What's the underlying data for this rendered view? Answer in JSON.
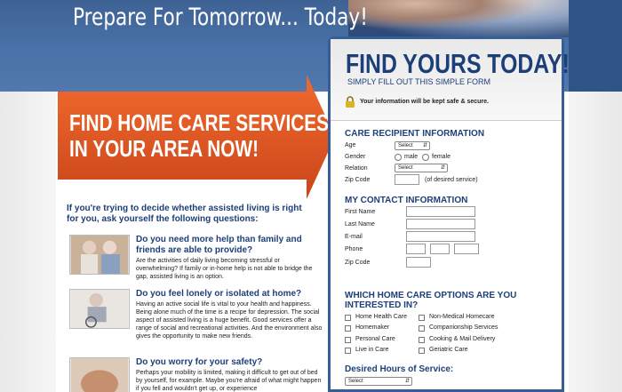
{
  "hero": {
    "title": "Prepare For Tomorrow... Today!"
  },
  "banner": {
    "line1": "FIND HOME CARE SERVICES",
    "line2": "IN YOUR AREA NOW!"
  },
  "intro": {
    "text": "If you're trying to decide whether assisted living is right for you, ask yourself the following questions:"
  },
  "questions": [
    {
      "title": "Do you need more help than family and friends are able to provide?",
      "body": "Are the activities of daily living becoming stressful or overwhelming? If family or in-home help is not able to bridge the gap, assisted living is an option."
    },
    {
      "title": "Do you feel lonely or isolated at home?",
      "body": "Having an active social life is vital to your health and happiness. Being alone much of the time is a recipe for depression. The social aspect of assisted living is a huge benefit. Good services offer a range of social and recreational activities. And the environment also gives the opportunity to make new friends."
    },
    {
      "title": "Do you worry for your safety?",
      "body": "Perhaps your mobility is limited, making it difficult to get out of bed by yourself, for example. Maybe you're afraid of what might happen if you fell and wouldn't get up, or experience"
    }
  ],
  "form": {
    "headline": "FIND YOURS TODAY!",
    "subheadline": "SIMPLY FILL OUT THIS SIMPLE FORM",
    "secure_note": "Your information will be kept safe & secure.",
    "care_recipient": {
      "heading": "CARE RECIPIENT INFORMATION",
      "age_label": "Age",
      "age_value": "Select",
      "gender_label": "Gender",
      "male_label": "male",
      "female_label": "female",
      "relation_label": "Relation",
      "relation_value": "Select",
      "zip_label": "Zip Code",
      "zip_note": "(of desired service)"
    },
    "contact": {
      "heading": "MY CONTACT INFORMATION",
      "first_name": "First Name",
      "last_name": "Last Name",
      "email": "E-mail",
      "phone": "Phone",
      "zip": "Zip Code"
    },
    "options": {
      "heading_line1": "WHICH HOME CARE OPTIONS ARE YOU",
      "heading_line2": "INTERESTED IN?",
      "left": [
        "Home Health Care",
        "Homemaker",
        "Personal Care",
        "Live in Care"
      ],
      "right": [
        "Non-Medical Homecare",
        "Companionship Services",
        "Cooking & Mail Delivery",
        "Geriatric Care"
      ]
    },
    "hours": {
      "heading": "Desired Hours of Service:",
      "value": "Select"
    }
  }
}
